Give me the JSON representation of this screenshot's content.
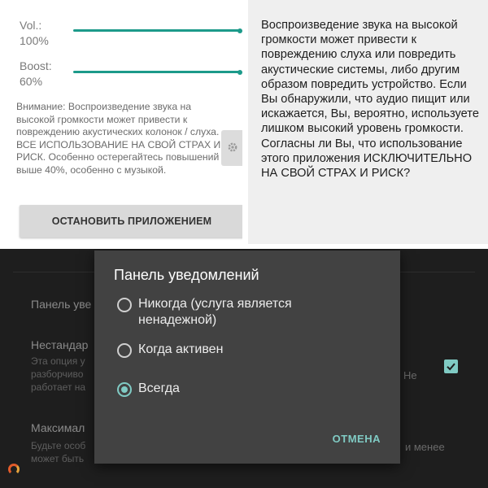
{
  "sound_screen": {
    "volume": {
      "label_line1": "Vol.:",
      "label_line2": "100%",
      "level_percent": 100
    },
    "boost": {
      "label_line1": "Boost:",
      "label_line2": "60%",
      "level_percent": 60
    },
    "warning_text": "Внимание: Воспроизведение звука на высокой громкости может привести к повреждению акустических колонок / слуха. ВСЕ ИСПОЛЬЗОВАНИЕ НА СВОЙ СТРАХ И РИСК. Особенно остерегайтесь повышений выше 40%, особенно с музыкой.",
    "stop_button_label": "ОСТАНОВИТЬ ПРИЛОЖЕНИЕМ",
    "side_button_icon": "gear-icon",
    "accent_color": "#1c9a8a"
  },
  "disclaimer": {
    "text": "Воспроизведение звука на высокой громкости может привести к повреждению слуха или повредить акустические системы, либо другим образом повредить устройство. Если Вы обнаружили, что аудио пищит или искажается, Вы, вероятно, используете лишком высокий уровень громкости. Согласны ли Вы, что использование этого приложения ИСКЛЮЧИТЕЛЬНО НА СВОЙ СТРАХ И РИСК?"
  },
  "settings_background": {
    "item1_title": "Панель уве",
    "item2_title": "Нестандар",
    "item2_sub_line1": "Эта опция у",
    "item2_sub_line2": "разборчиво",
    "item2_sub_line3": "работает на",
    "item2_sub_right": "Не",
    "item2_checked": true,
    "item3_title": "Максимал",
    "item3_sub_line1": "Будьте особ",
    "item3_sub_line2": "может быть",
    "item3_sub_right": "и менее"
  },
  "dialog": {
    "title": "Панель уведомлений",
    "options": [
      {
        "label": "Никогда (услуга является ненадежной)",
        "selected": false
      },
      {
        "label": "Когда активен",
        "selected": false
      },
      {
        "label": "Всегда",
        "selected": true
      }
    ],
    "cancel_label": "ОТМЕНА",
    "accent_color": "#80cbc4"
  }
}
